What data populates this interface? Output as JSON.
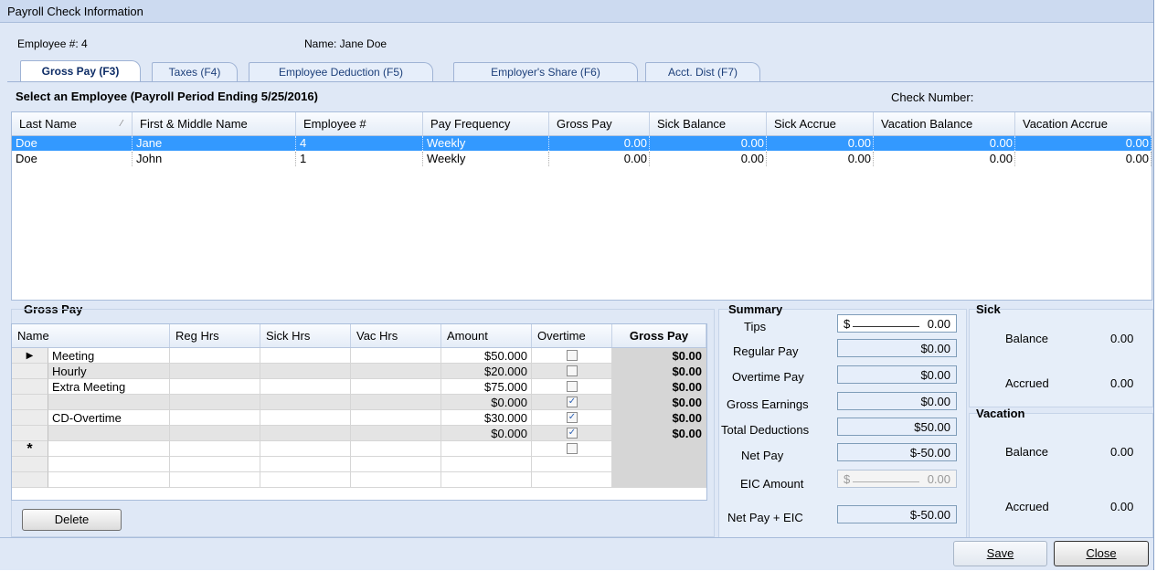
{
  "window": {
    "title": "Payroll Check Information"
  },
  "header": {
    "employee_no": "Employee #: 4",
    "name": "Name: Jane  Doe"
  },
  "tabs": [
    {
      "label": "Gross Pay (F3)"
    },
    {
      "label": "Taxes (F4)"
    },
    {
      "label": "Employee Deduction (F5)"
    },
    {
      "label": "Employer's Share (F6)"
    },
    {
      "label": "Acct. Dist (F7)"
    }
  ],
  "employees": {
    "section_title": "Select an Employee (Payroll Period Ending 5/25/2016)",
    "check_number_label": "Check Number:",
    "columns": [
      "Last Name",
      "First & Middle Name",
      "Employee #",
      "Pay Frequency",
      "Gross Pay",
      "Sick Balance",
      "Sick Accrue",
      "Vacation Balance",
      "Vacation Accrue"
    ],
    "rows": [
      {
        "last": "Doe",
        "first": "Jane",
        "emp_no": "4",
        "freq": "Weekly",
        "gross": "0.00",
        "sick_bal": "0.00",
        "sick_acc": "0.00",
        "vac_bal": "0.00",
        "vac_acc": "0.00"
      },
      {
        "last": "Doe",
        "first": "John",
        "emp_no": "1",
        "freq": "Weekly",
        "gross": "0.00",
        "sick_bal": "0.00",
        "sick_acc": "0.00",
        "vac_bal": "0.00",
        "vac_acc": "0.00"
      }
    ]
  },
  "gross_pay": {
    "section_title": "Gross Pay",
    "columns": [
      "Name",
      "Reg Hrs",
      "Sick Hrs",
      "Vac Hrs",
      "Amount",
      "Overtime",
      "Gross Pay"
    ],
    "rows": [
      {
        "name": "Meeting",
        "amount": "$50.000",
        "overtime": false,
        "gross": "$0.00"
      },
      {
        "name": "Hourly",
        "amount": "$20.000",
        "overtime": false,
        "gross": "$0.00"
      },
      {
        "name": "Extra Meeting",
        "amount": "$75.000",
        "overtime": false,
        "gross": "$0.00"
      },
      {
        "name": "",
        "amount": "$0.000",
        "overtime": true,
        "gross": "$0.00"
      },
      {
        "name": "CD-Overtime",
        "amount": "$30.000",
        "overtime": true,
        "gross": "$0.00"
      },
      {
        "name": "",
        "amount": "$0.000",
        "overtime": true,
        "gross": "$0.00"
      }
    ],
    "new_row_marker": "*",
    "delete_label": "Delete"
  },
  "summary": {
    "title": "Summary",
    "tips_label": "Tips",
    "tips_value": "0.00",
    "tips_prefix": "$",
    "regular_pay_label": "Regular Pay",
    "regular_pay": "$0.00",
    "overtime_pay_label": "Overtime Pay",
    "overtime_pay": "$0.00",
    "gross_earnings_label": "Gross Earnings",
    "gross_earnings": "$0.00",
    "total_deductions_label": "Total Deductions",
    "total_deductions": "$50.00",
    "net_pay_label": "Net Pay",
    "net_pay": "$-50.00",
    "eic_label": "EIC Amount",
    "eic_value": "0.00",
    "eic_prefix": "$",
    "net_eic_label": "Net Pay + EIC",
    "net_eic": "$-50.00"
  },
  "sick": {
    "title": "Sick",
    "balance_label": "Balance",
    "balance": "0.00",
    "accrued_label": "Accrued",
    "accrued": "0.00"
  },
  "vacation": {
    "title": "Vacation",
    "balance_label": "Balance",
    "balance": "0.00",
    "accrued_label": "Accrued",
    "accrued": "0.00"
  },
  "buttons": {
    "save": "Save",
    "close": "Close"
  }
}
